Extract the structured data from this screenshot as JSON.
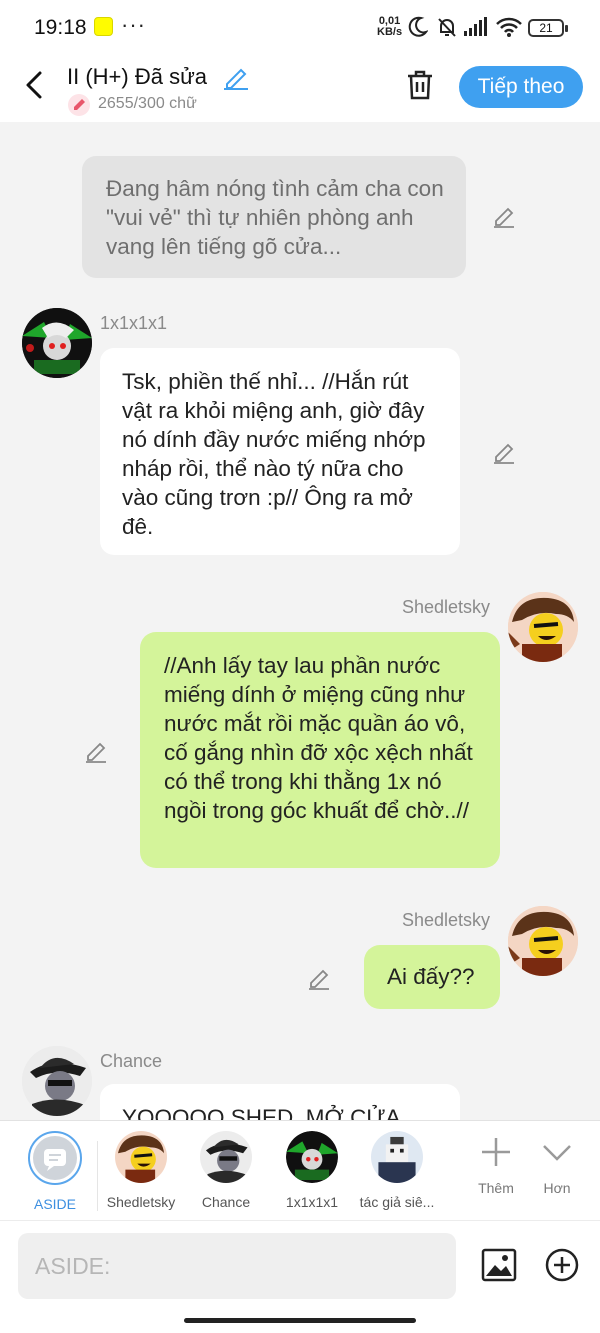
{
  "status_bar": {
    "time": "19:18",
    "net_speed_value": "0,01",
    "net_speed_unit": "KB/s",
    "battery": "21"
  },
  "header": {
    "title": "II (H+) Đã sửa",
    "char_count": "2655/300 chữ",
    "next_label": "Tiếp theo"
  },
  "messages": [
    {
      "type": "aside",
      "text": "Đang hâm nóng tình cảm cha con \"vui vẻ\" thì tự nhiên phòng anh vang lên tiếng gõ cửa..."
    },
    {
      "type": "left",
      "sender": "1x1x1x1",
      "text": "Tsk, phiền thế nhỉ... //Hắn rút vật ra khỏi miệng anh, giờ đây nó dính đầy nước miếng nhớp nháp rồi, thể nào tý nữa cho vào cũng trơn :p// Ông ra mở đê."
    },
    {
      "type": "right",
      "sender": "Shedletsky",
      "text": "//Anh lấy tay lau phần nước miếng dính ở miệng cũng như nước mắt rồi mặc quần áo vô, cố gắng nhìn đỡ xộc xệch nhất có thể trong khi thằng 1x nó ngồi trong góc khuất để chờ..//"
    },
    {
      "type": "right",
      "sender": "Shedletsky",
      "text": "Ai đấy??"
    },
    {
      "type": "left",
      "sender": "Chance",
      "text": "YOOOOO SHED, MỞ CỬA"
    }
  ],
  "characters": [
    {
      "label": "ASIDE",
      "icon": "chat-bubble-icon",
      "selected": true
    },
    {
      "label": "Shedletsky",
      "icon": "avatar-shedletsky"
    },
    {
      "label": "Chance",
      "icon": "avatar-chance"
    },
    {
      "label": "1x1x1x1",
      "icon": "avatar-1x1x1x1"
    },
    {
      "label": "tác giả siê...",
      "icon": "avatar-author"
    }
  ],
  "tools": {
    "add_label": "Thêm",
    "more_label": "Hơn"
  },
  "composer": {
    "placeholder": "ASIDE:"
  },
  "colors": {
    "accent": "#3fa0f0",
    "right_bubble": "#d4f49a",
    "aside_bubble": "#e3e3e3"
  }
}
